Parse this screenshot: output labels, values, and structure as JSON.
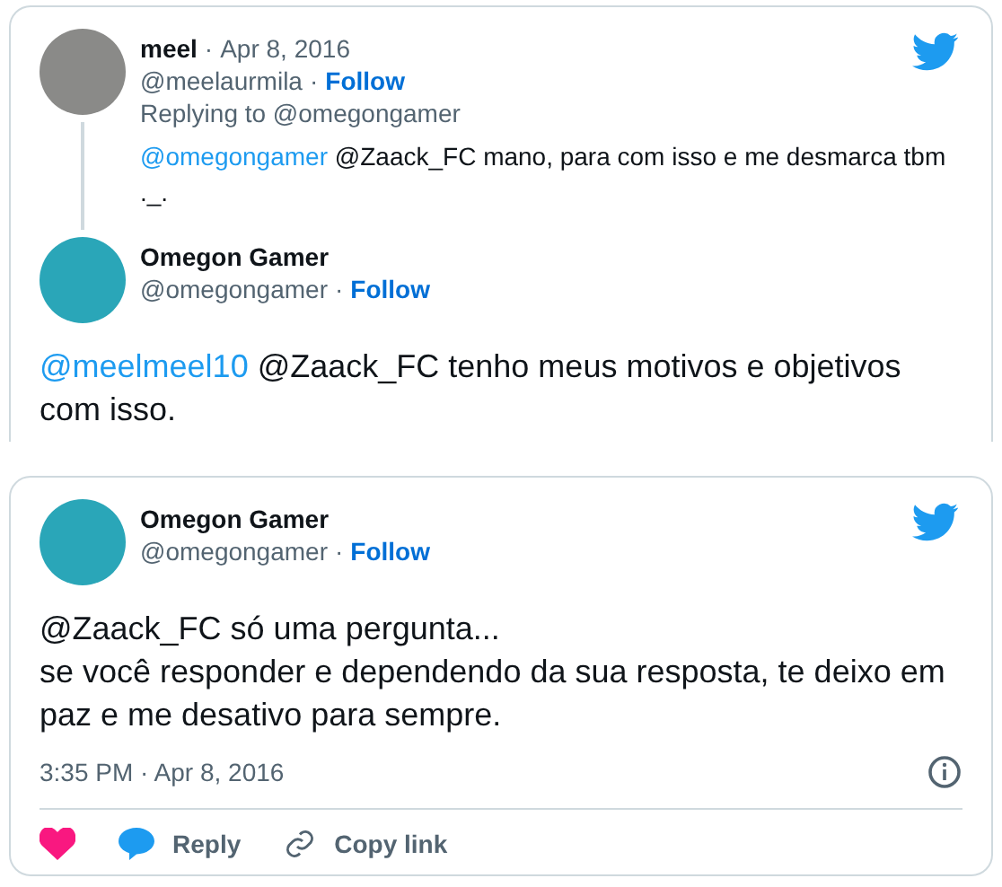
{
  "cards": [
    {
      "kind": "thread",
      "parent": {
        "name": "meel",
        "date_sep": "·",
        "date": "Apr 8, 2016",
        "handle": "@meelaurmila",
        "follow_sep": "·",
        "follow": "Follow",
        "replying": "Replying to @omegongamer",
        "mention": "@omegongamer",
        "text": "@Zaack_FC mano, para com isso e me desmarca tbm ._."
      },
      "reply": {
        "name": "Omegon Gamer",
        "handle": "@omegongamer",
        "follow_sep": "·",
        "follow": "Follow",
        "mention": "@meelmeel10",
        "text": "@Zaack_FC tenho meus motivos e objetivos com isso."
      }
    },
    {
      "kind": "tweet",
      "name": "Omegon Gamer",
      "handle": "@omegongamer",
      "follow_sep": "·",
      "follow": "Follow",
      "lines": [
        "@Zaack_FC só uma pergunta...",
        "se você responder e dependendo da sua resposta, te deixo em paz e me desativo para sempre."
      ],
      "time": "3:35 PM · Apr 8, 2016",
      "liked": true,
      "reply": "Reply",
      "copy": "Copy link"
    }
  ]
}
